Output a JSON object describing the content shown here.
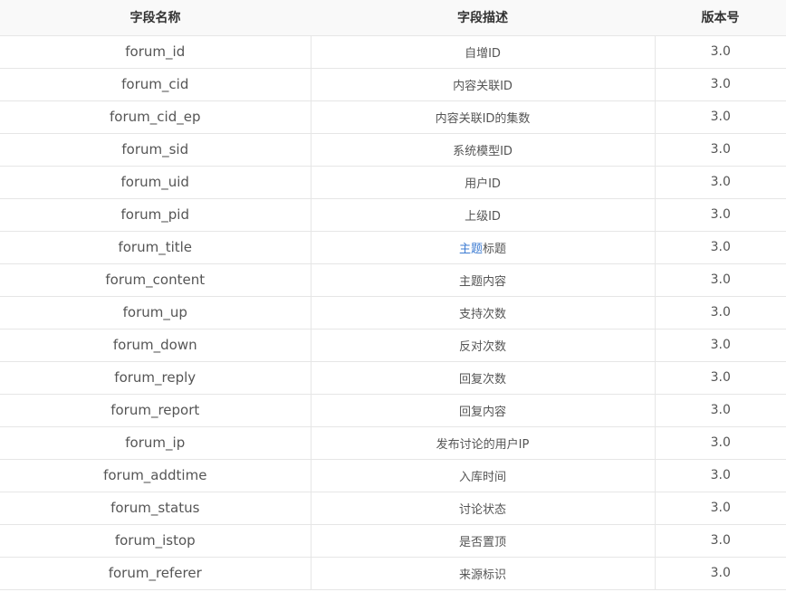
{
  "table": {
    "headers": {
      "name": "字段名称",
      "description": "字段描述",
      "version": "版本号"
    },
    "rows": [
      {
        "name": "forum_id",
        "description": "自增ID",
        "version": "3.0"
      },
      {
        "name": "forum_cid",
        "description": "内容关联ID",
        "version": "3.0"
      },
      {
        "name": "forum_cid_ep",
        "description": "内容关联ID的集数",
        "version": "3.0"
      },
      {
        "name": "forum_sid",
        "description": "系统模型ID",
        "version": "3.0"
      },
      {
        "name": "forum_uid",
        "description": "用户ID",
        "version": "3.0"
      },
      {
        "name": "forum_pid",
        "description": "上级ID",
        "version": "3.0"
      },
      {
        "name": "forum_title",
        "description_link": "主题",
        "description": "标题",
        "version": "3.0"
      },
      {
        "name": "forum_content",
        "description": "主题内容",
        "version": "3.0"
      },
      {
        "name": "forum_up",
        "description": "支持次数",
        "version": "3.0"
      },
      {
        "name": "forum_down",
        "description": "反对次数",
        "version": "3.0"
      },
      {
        "name": "forum_reply",
        "description": "回复次数",
        "version": "3.0"
      },
      {
        "name": "forum_report",
        "description": "回复内容",
        "version": "3.0"
      },
      {
        "name": "forum_ip",
        "description": "发布讨论的用户IP",
        "version": "3.0"
      },
      {
        "name": "forum_addtime",
        "description": "入库时间",
        "version": "3.0"
      },
      {
        "name": "forum_status",
        "description": "讨论状态",
        "version": "3.0"
      },
      {
        "name": "forum_istop",
        "description": "是否置顶",
        "version": "3.0"
      },
      {
        "name": "forum_referer",
        "description": "来源标识",
        "version": "3.0"
      }
    ]
  },
  "colors": {
    "link": "#3c7bd2",
    "border": "#e6e6e6",
    "header_bg": "#f9f9f9"
  }
}
